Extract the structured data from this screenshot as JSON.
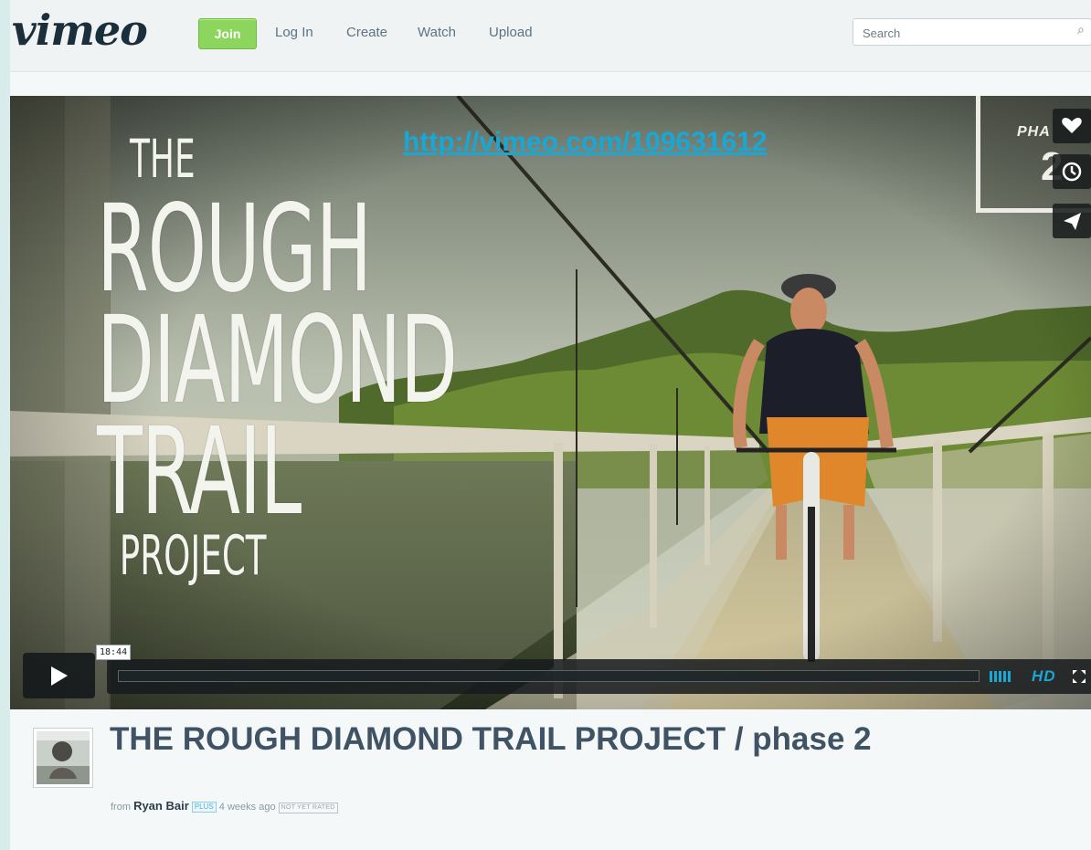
{
  "header": {
    "logo": "vimeo",
    "join_label": "Join",
    "nav": [
      "Log In",
      "Create",
      "Watch",
      "Upload"
    ],
    "search_placeholder": "Search"
  },
  "player": {
    "title_art": {
      "line1": "THE",
      "line2": "ROUGH",
      "line3": "DIAMOND",
      "line4": "TRAIL",
      "line5": "PROJECT"
    },
    "url_overlay": " http://vimeo.com/109631612",
    "phase_badge": {
      "label": "PHA",
      "number": "2"
    },
    "side_actions": [
      "heart-icon",
      "clock-icon",
      "send-icon"
    ],
    "time_label": "18:44",
    "progress": 0,
    "hd_label": "HD",
    "accent_color": "#19a7d6"
  },
  "video": {
    "title": "THE ROUGH DIAMOND TRAIL PROJECT / phase 2",
    "byline_from": "from",
    "user": "Ryan Bair",
    "user_badge": "PLUS",
    "posted": "4 weeks ago",
    "rating": "NOT YET RATED"
  }
}
